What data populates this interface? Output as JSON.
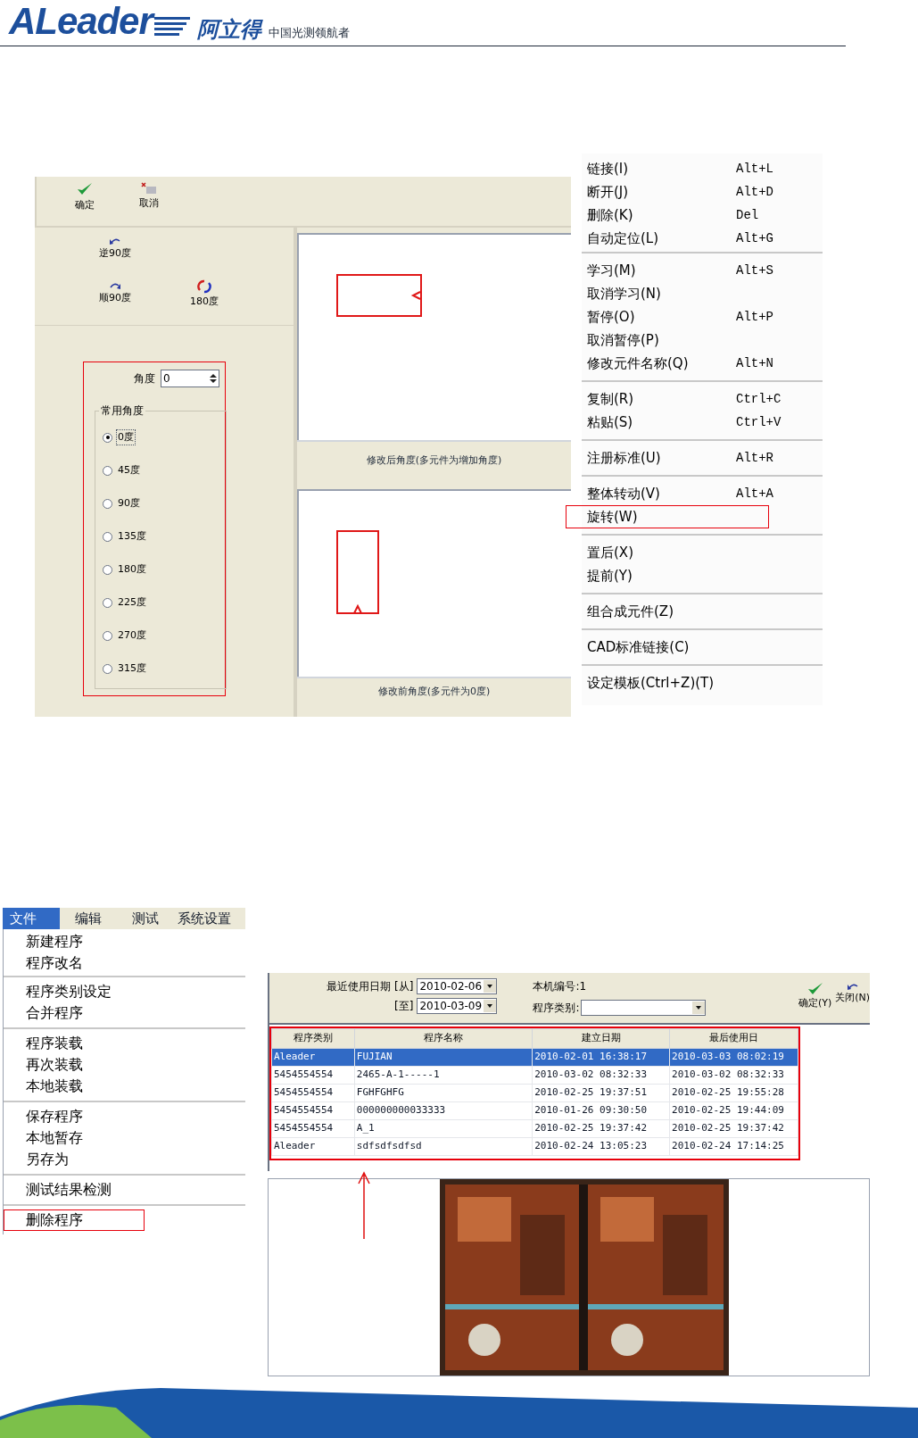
{
  "header": {
    "wordmark": "ALeader",
    "name": "阿立得",
    "slogan": "中国光测领航者"
  },
  "rotate_dialog": {
    "toolbar": [
      {
        "kind": "ok",
        "label": "确定"
      },
      {
        "kind": "cancel",
        "label": "取消"
      }
    ],
    "rotate_buttons": [
      {
        "kind": "ccw",
        "label": "逆90度"
      },
      {
        "kind": "cw",
        "label": "顺90度"
      },
      {
        "kind": "half",
        "label": "180度"
      }
    ],
    "angle": {
      "label": "角度",
      "value": "0"
    },
    "common_angles": {
      "title": "常用角度",
      "options": [
        {
          "label": "0度",
          "selected": true
        },
        {
          "label": "45度",
          "selected": false
        },
        {
          "label": "90度",
          "selected": false
        },
        {
          "label": "135度",
          "selected": false
        },
        {
          "label": "180度",
          "selected": false
        },
        {
          "label": "225度",
          "selected": false
        },
        {
          "label": "270度",
          "selected": false
        },
        {
          "label": "315度",
          "selected": false
        }
      ]
    },
    "previews": [
      {
        "kind": "horizontal",
        "caption": "修改后角度(多元件为增加角度)"
      },
      {
        "kind": "vertical",
        "caption": "修改前角度(多元件为0度)"
      }
    ]
  },
  "context_menu": {
    "groups": [
      [
        {
          "label": "链接(I)",
          "shortcut": "Alt+L",
          "highlighted": false
        },
        {
          "label": "断开(J)",
          "shortcut": "Alt+D",
          "highlighted": false
        },
        {
          "label": "删除(K)",
          "shortcut": "Del",
          "highlighted": false
        },
        {
          "label": "自动定位(L)",
          "shortcut": "Alt+G",
          "highlighted": false
        }
      ],
      [
        {
          "label": "学习(M)",
          "shortcut": "Alt+S",
          "highlighted": false
        },
        {
          "label": "取消学习(N)",
          "highlighted": false
        },
        {
          "label": "暂停(O)",
          "shortcut": "Alt+P",
          "highlighted": false
        },
        {
          "label": "取消暂停(P)",
          "highlighted": false
        },
        {
          "label": "修改元件名称(Q)",
          "shortcut": "Alt+N",
          "highlighted": false
        }
      ],
      [
        {
          "label": "复制(R)",
          "shortcut": "Ctrl+C",
          "highlighted": false
        },
        {
          "label": "粘贴(S)",
          "shortcut": "Ctrl+V",
          "highlighted": false
        }
      ],
      [
        {
          "label": "注册标准(U)",
          "shortcut": "Alt+R",
          "highlighted": false
        }
      ],
      [
        {
          "label": "整体转动(V)",
          "shortcut": "Alt+A",
          "highlighted": false
        },
        {
          "label": "旋转(W)",
          "highlighted": true
        }
      ],
      [
        {
          "label": "置后(X)",
          "highlighted": false
        },
        {
          "label": "提前(Y)",
          "highlighted": false
        }
      ],
      [
        {
          "label": "组合成元件(Z)",
          "highlighted": false
        }
      ],
      [
        {
          "label": "CAD标准链接(C)",
          "highlighted": false
        }
      ],
      [
        {
          "label": "设定模板(Ctrl+Z)(T)",
          "highlighted": false
        }
      ]
    ]
  },
  "file_menu": {
    "menubar": [
      {
        "label": "文件",
        "selected": true
      },
      {
        "label": "编辑",
        "selected": false
      },
      {
        "label": "测试",
        "selected": false
      },
      {
        "label": "系统设置",
        "selected": false
      }
    ],
    "groups": [
      [
        {
          "label": "新建程序",
          "highlighted": false
        },
        {
          "label": "程序改名",
          "highlighted": false
        }
      ],
      [
        {
          "label": "程序类别设定",
          "highlighted": false
        },
        {
          "label": "合并程序",
          "highlighted": false
        }
      ],
      [
        {
          "label": "程序装载",
          "highlighted": false
        },
        {
          "label": "再次装载",
          "highlighted": false
        },
        {
          "label": "本地装载",
          "highlighted": false
        }
      ],
      [
        {
          "label": "保存程序",
          "highlighted": false
        },
        {
          "label": "本地暂存",
          "highlighted": false
        },
        {
          "label": "另存为",
          "highlighted": false
        }
      ],
      [
        {
          "label": "测试结果检测",
          "highlighted": false
        }
      ],
      [
        {
          "label": "删除程序",
          "highlighted": true
        }
      ]
    ]
  },
  "program_window": {
    "filters": {
      "date_label": "最近使用日期",
      "from_label": "[从]",
      "from_value": "2010-02-06",
      "to_label": "[至]",
      "to_value": "2010-03-09",
      "machine": "本机编号:1",
      "category_label": "程序类别:"
    },
    "buttons": [
      {
        "kind": "ok",
        "label": "确定(Y)"
      },
      {
        "kind": "close",
        "label": "关闭(N)"
      }
    ],
    "table": {
      "columns": [
        "程序类别",
        "程序名称",
        "建立日期",
        "最后使用日"
      ],
      "rows": [
        {
          "cells": [
            "Aleader",
            "FUJIAN",
            "2010-02-01 16:38:17",
            "2010-03-03 08:02:19"
          ],
          "selected": true
        },
        {
          "cells": [
            "5454554554",
            "2465-A-1-----1",
            "2010-03-02 08:32:33",
            "2010-03-02 08:32:33"
          ],
          "selected": false
        },
        {
          "cells": [
            "5454554554",
            "FGHFGHFG",
            "2010-02-25 19:37:51",
            "2010-02-25 19:55:28"
          ],
          "selected": false
        },
        {
          "cells": [
            "5454554554",
            "000000000033333",
            "2010-01-26 09:30:50",
            "2010-02-25 19:44:09"
          ],
          "selected": false
        },
        {
          "cells": [
            "5454554554",
            "A_1",
            "2010-02-25 19:37:42",
            "2010-02-25 19:37:42"
          ],
          "selected": false
        },
        {
          "cells": [
            "Aleader",
            "sdfsdfsdfsd",
            "2010-02-24 13:05:23",
            "2010-02-24 17:14:25"
          ],
          "selected": false
        }
      ]
    }
  }
}
